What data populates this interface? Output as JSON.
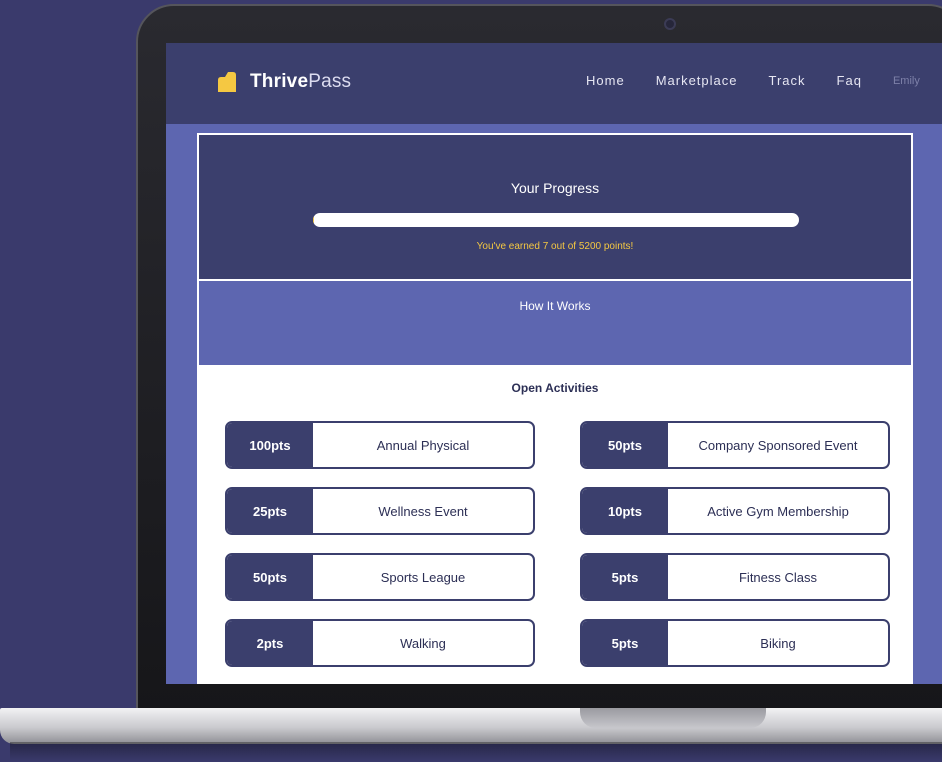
{
  "brand": {
    "name_bold": "Thrive",
    "name_light": "Pass",
    "color": "#f5c842"
  },
  "nav": {
    "items": [
      {
        "label": "Home"
      },
      {
        "label": "Marketplace"
      },
      {
        "label": "Track"
      },
      {
        "label": "Faq"
      }
    ],
    "user_name": "Emily"
  },
  "progress": {
    "title": "Your Progress",
    "earned": 7,
    "total": 5200,
    "message": "You've earned 7 out of 5200 points!"
  },
  "how_it_works": {
    "title": "How It Works"
  },
  "activities": {
    "title": "Open Activities",
    "left": [
      {
        "points": "100pts",
        "name": "Annual Physical"
      },
      {
        "points": "25pts",
        "name": "Wellness Event"
      },
      {
        "points": "50pts",
        "name": "Sports League"
      },
      {
        "points": "2pts",
        "name": "Walking"
      }
    ],
    "right": [
      {
        "points": "50pts",
        "name": "Company Sponsored Event"
      },
      {
        "points": "10pts",
        "name": "Active Gym Membership"
      },
      {
        "points": "5pts",
        "name": "Fitness Class"
      },
      {
        "points": "5pts",
        "name": "Biking"
      }
    ]
  },
  "colors": {
    "navy": "#3b3f6d",
    "periwinkle": "#5d66b0",
    "accent": "#f5c842"
  }
}
